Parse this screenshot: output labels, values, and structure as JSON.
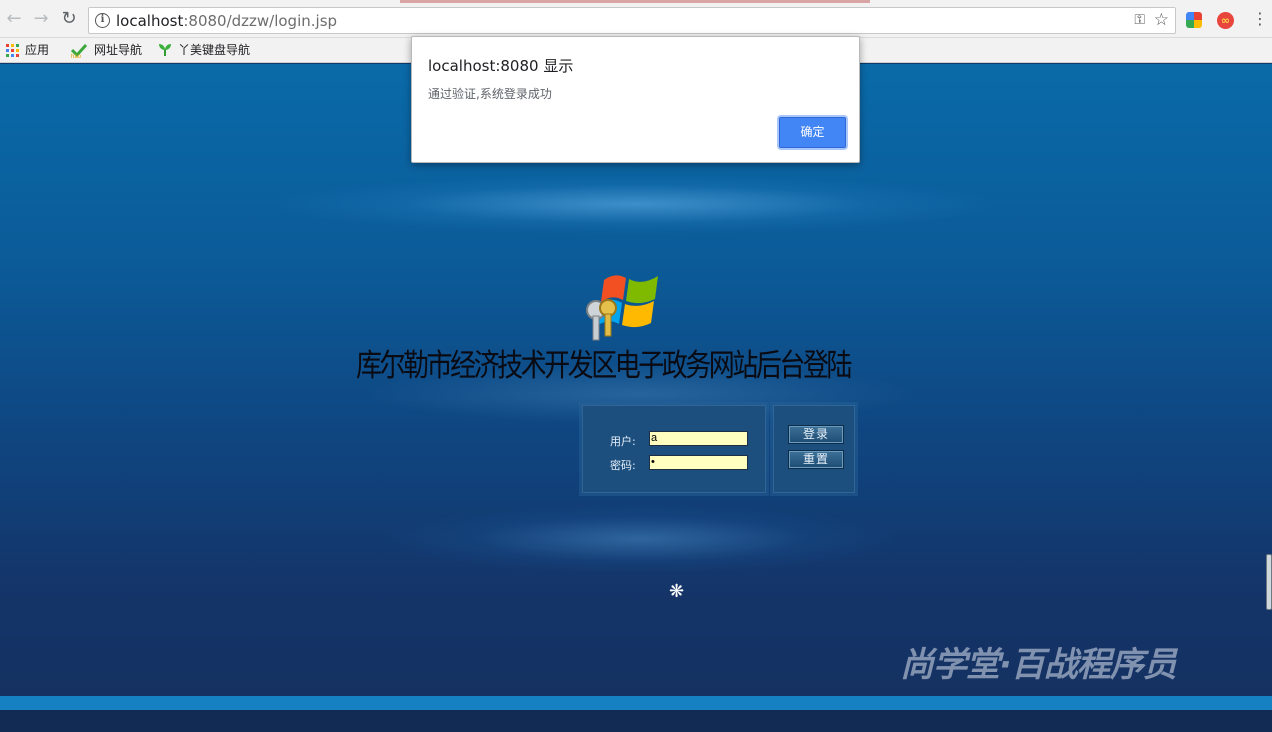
{
  "browser": {
    "url_host": "localhost",
    "url_path": ":8080/dzzw/login.jsp",
    "bookmarks": [
      {
        "label": "应用"
      },
      {
        "label": "网址导航"
      },
      {
        "label": "丫美键盘导航"
      }
    ]
  },
  "dialog": {
    "title": "localhost:8080 显示",
    "message": "通过验证,系统登录成功",
    "ok_label": "确定"
  },
  "login": {
    "site_title": "库尔勒市经济技术开发区电子政务网站后台登陆",
    "username_label": "用户:",
    "username_value": "a",
    "password_label": "密码:",
    "password_value": "•",
    "login_button": "登录",
    "reset_button": "重置"
  },
  "spinner_glyph": "❋",
  "watermark": "尚学堂·百战程序员"
}
